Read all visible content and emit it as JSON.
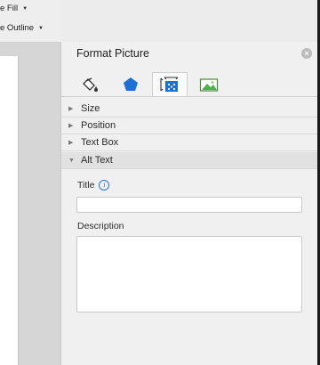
{
  "ribbon": {
    "fill_label": "e Fill",
    "outline_label": "e Outline",
    "caret": "▼"
  },
  "pane": {
    "title": "Format Picture",
    "close_glyph": "×",
    "tabs": [
      {
        "icon": "fill-bucket-icon",
        "active": false
      },
      {
        "icon": "effects-pentagon-icon",
        "active": false
      },
      {
        "icon": "size-properties-icon",
        "active": true
      },
      {
        "icon": "picture-icon",
        "active": false
      }
    ],
    "sections": [
      {
        "label": "Size",
        "expanded": false,
        "arrow": "▶"
      },
      {
        "label": "Position",
        "expanded": false,
        "arrow": "▶"
      },
      {
        "label": "Text Box",
        "expanded": false,
        "arrow": "▶"
      },
      {
        "label": "Alt Text",
        "expanded": true,
        "arrow": "▼"
      }
    ],
    "alt_text": {
      "title_label": "Title",
      "info_glyph": "i",
      "title_value": "",
      "description_label": "Description",
      "description_value": ""
    }
  }
}
